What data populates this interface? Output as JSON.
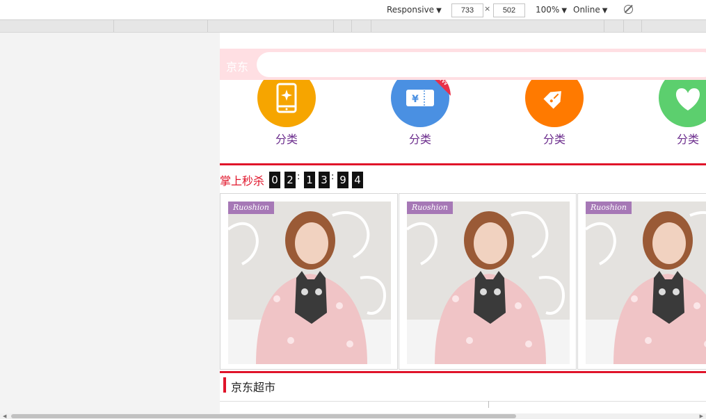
{
  "devtools": {
    "device_mode": "Responsive",
    "width": "733",
    "height": "502",
    "times": "×",
    "zoom": "100%",
    "throttle": "Online",
    "rotate_icon": "rotate-icon"
  },
  "header": {
    "logo": "京东",
    "search_placeholder": ""
  },
  "nav": {
    "items": [
      {
        "label": "分类",
        "icon": "phone-icon",
        "color": "#f6a500"
      },
      {
        "label": "分类",
        "icon": "ticket-icon",
        "color": "#4a90e2",
        "badge": "NEW"
      },
      {
        "label": "分类",
        "icon": "price-tag-icon",
        "color": "#ff7a00"
      },
      {
        "label": "分类",
        "icon": "heart-icon",
        "color": "#5ccf6e"
      }
    ]
  },
  "seckill": {
    "title": "掌上秒杀",
    "digits": [
      "0",
      "2",
      "1",
      "3",
      "9",
      "4"
    ],
    "separator": ":"
  },
  "products": [
    {
      "brand": "Ruoshion"
    },
    {
      "brand": "Ruoshion"
    },
    {
      "brand": "Ruoshion"
    }
  ],
  "section": {
    "title": "京东超市"
  },
  "colors": {
    "accent_red": "#e0142a",
    "header_bg": "#ffdfe3",
    "nav_label": "#6b2c8c"
  }
}
